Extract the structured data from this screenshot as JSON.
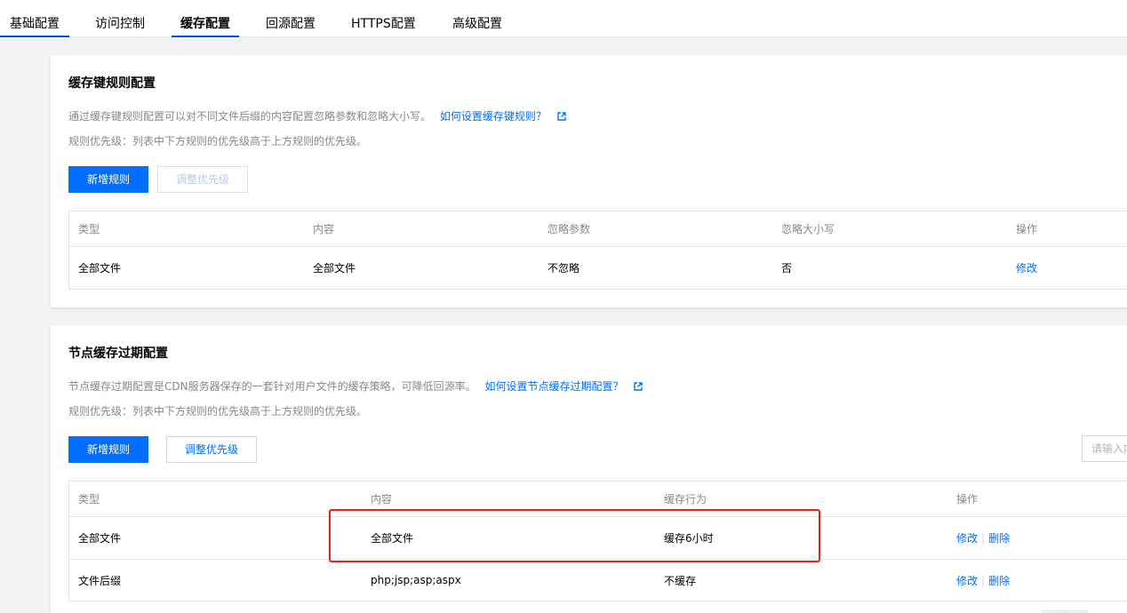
{
  "tabs": [
    {
      "label": "基础配置",
      "active": false
    },
    {
      "label": "访问控制",
      "active": false
    },
    {
      "label": "缓存配置",
      "active": true
    },
    {
      "label": "回源配置",
      "active": false
    },
    {
      "label": "HTTPS配置",
      "active": false
    },
    {
      "label": "高级配置",
      "active": false
    }
  ],
  "cache_key": {
    "title": "缓存键规则配置",
    "desc": "通过缓存键规则配置可以对不同文件后缀的内容配置忽略参数和忽略大小写。",
    "help_link": "如何设置缓存键规则？",
    "priority_note": "规则优先级：列表中下方规则的优先级高于上方规则的优先级。",
    "add_button": "新增规则",
    "priority_button": "调整优先级",
    "columns": [
      "类型",
      "内容",
      "忽略参数",
      "忽略大小写",
      "操作"
    ],
    "rows": [
      {
        "type": "全部文件",
        "content": "全部文件",
        "ignore_params": "不忽略",
        "ignore_case": "否",
        "action": "修改"
      }
    ]
  },
  "node_cache": {
    "title": "节点缓存过期配置",
    "desc": "节点缓存过期配置是CDN服务器保存的一套针对用户文件的缓存策略，可降低回源率。",
    "help_link": "如何设置节点缓存过期配置？",
    "priority_note": "规则优先级：列表中下方规则的优先级高于上方规则的优先级。",
    "add_button": "新增规则",
    "priority_button": "调整优先级",
    "search_placeholder": "请输入内",
    "columns": [
      "类型",
      "内容",
      "缓存行为",
      "操作"
    ],
    "rows": [
      {
        "type": "全部文件",
        "content": "全部文件",
        "behavior": "缓存6小时",
        "edit": "修改",
        "delete": "删除"
      },
      {
        "type": "文件后缀",
        "content": "php;jsp;asp;aspx",
        "behavior": "不缓存",
        "edit": "修改",
        "delete": "删除"
      }
    ]
  },
  "colors": {
    "accent": "#006eff",
    "tab_underline": "#0052d9",
    "highlight": "#e8211b"
  }
}
